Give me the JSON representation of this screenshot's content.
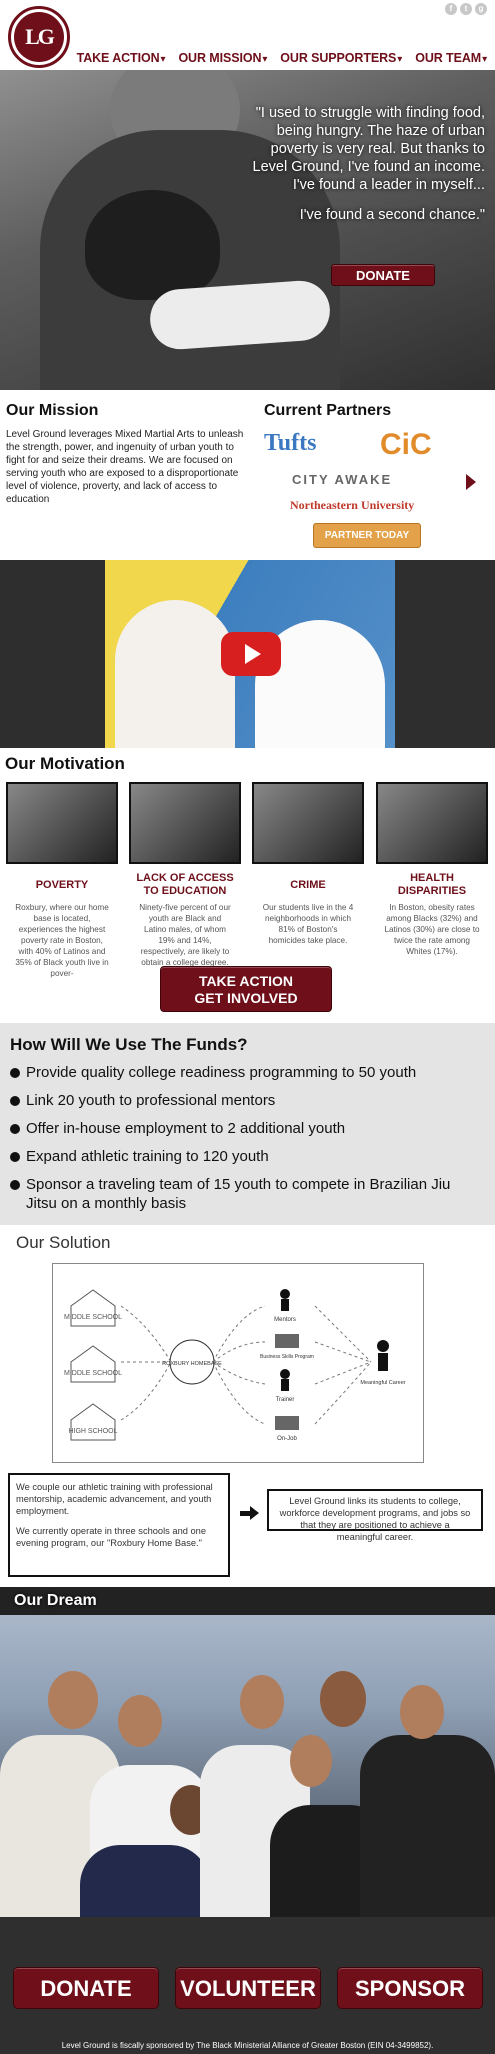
{
  "logo": {
    "text": "LG"
  },
  "social": [
    "f",
    "t",
    "g"
  ],
  "nav": {
    "items": [
      "TAKE ACTION",
      "OUR MISSION",
      "OUR SUPPORTERS",
      "OUR TEAM"
    ]
  },
  "hero": {
    "quote1": "\"I used to struggle with finding food, being hungry. The haze of urban poverty is very real. But thanks to Level Ground, I've found an income. I've found a leader in myself...",
    "quote2": "I've found a second chance.\"",
    "donate": "DONATE"
  },
  "mission": {
    "title": "Our Mission",
    "text": "Level Ground leverages Mixed Martial Arts to unleash the strength, power, and ingenuity of urban youth to fight for and seize their dreams. We are focused on serving youth who are exposed to a disproportionate level of violence, proverty, and lack of access to education"
  },
  "partners": {
    "title": "Current Partners",
    "names": [
      "Tufts",
      "CiC",
      "CITY AWAKE",
      "Northeastern University"
    ],
    "button": "PARTNER TODAY"
  },
  "motivation": {
    "title": "Our Motivation",
    "cards": [
      {
        "title": "POVERTY",
        "desc": "Roxbury, where our home base is located, experiences the highest poverty rate in Boston, with 40% of Latinos and 35% of Black youth live in pover-"
      },
      {
        "title": "LACK OF ACCESS TO EDUCATION",
        "desc": "Ninety-five percent of our youth are Black and Latino males, of whom 19% and 14%, respectively, are likely to obtain a college degree."
      },
      {
        "title": "CRIME",
        "desc": "Our students live in the 4 neighborhoods in which 81% of Boston's homicides take place."
      },
      {
        "title": "HEALTH DISPARITIES",
        "desc": "In Boston, obesity rates among Blacks (32%) and Latinos (30%) are close to twice the rate among Whites (17%)."
      }
    ],
    "button_line1": "TAKE ACTION",
    "button_line2": "GET INVOLVED"
  },
  "funds": {
    "title": "How Will We Use The Funds?",
    "items": [
      "Provide quality college readiness programming to 50 youth",
      "Link 20 youth to professional mentors",
      "Offer in-house employment to 2 additional youth",
      "Expand athletic training to 120 youth",
      "Sponsor a traveling team of 15 youth to compete in Brazilian Jiu Jitsu on a monthly basis"
    ]
  },
  "solution": {
    "title": "Our Solution",
    "diagram": {
      "schools": [
        "MIDDLE SCHOOL",
        "MIDDLE SCHOOL",
        "HIGH SCHOOL"
      ],
      "hub": "ROXBURY HOMEBASE",
      "outcomes": [
        "Mentors",
        "Business Skills Program",
        "Trainer",
        "On-Job"
      ],
      "career": "Meaningful Career"
    },
    "box1_p1": "We couple our athletic training with professional mentorship, academic advancement, and youth employment.",
    "box1_p2": "We currently operate in three schools and one evening program, our \"Roxbury Home Base.\"",
    "box2": "Level Ground links its students to college, workforce development programs, and jobs so that they are positioned to achieve a meaningful career."
  },
  "dream": {
    "title": "Our Dream"
  },
  "bottom": {
    "buttons": [
      "DONATE",
      "VOLUNTEER",
      "SPONSOR"
    ],
    "footer": "Level Ground is fiscally sponsored by The Black Ministerial Alliance of Greater Boston (EIN 04-3499852)."
  }
}
